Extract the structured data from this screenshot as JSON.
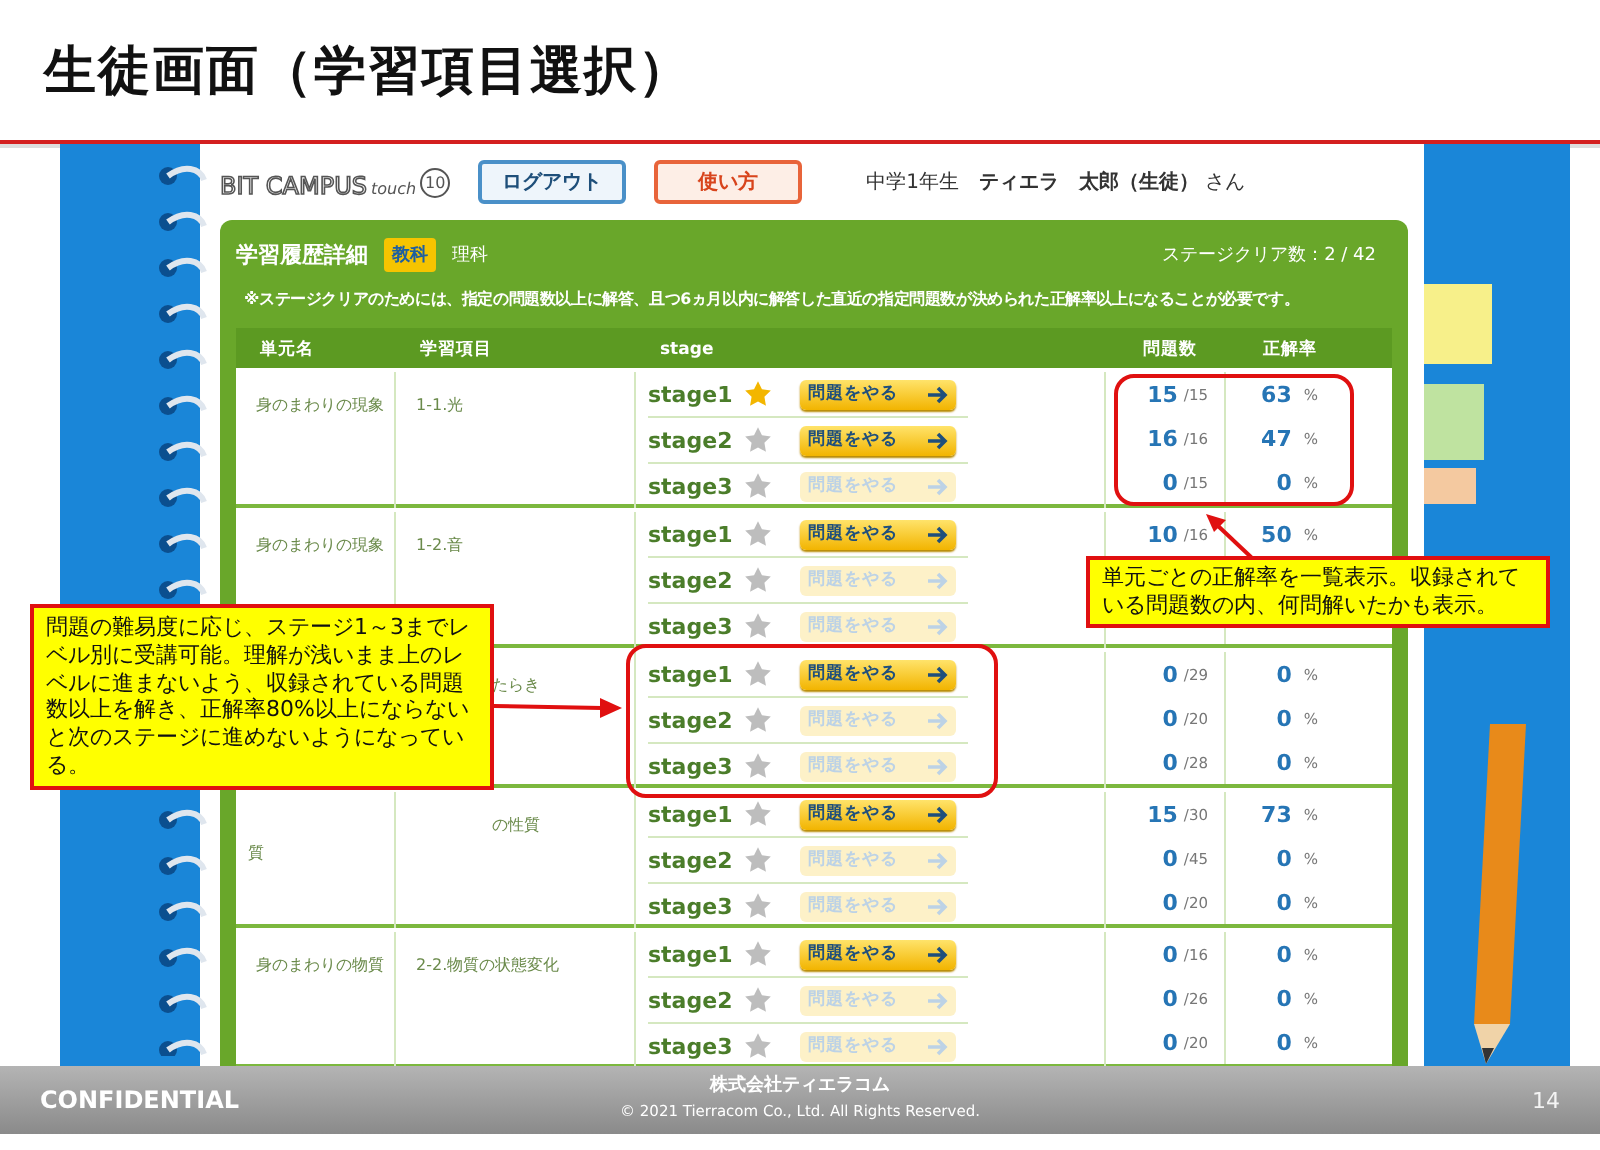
{
  "slide_title": "生徒画面（学習項目選択）",
  "app": {
    "logo": {
      "main": "BIT CAMPUS",
      "sub": "touch",
      "badge": "10"
    },
    "buttons": [
      {
        "label": "ログアウト",
        "kind": "logout"
      },
      {
        "label": "使い方",
        "kind": "help"
      }
    ],
    "user": {
      "grade": "中学1年生",
      "school": "ティエラ",
      "name": "太郎（生徒）",
      "suffix": "さん"
    },
    "panel": {
      "title": "学習履歴詳細",
      "subject_tag": "教科",
      "subject": "理科",
      "clear_count": "ステージクリア数：2 / 42",
      "note": "※ステージクリアのためには、指定の問題数以上に解答、且つ**6**ヵ月以内に解答した直近の指定問題数が決められた正解率以上になることが必要です。",
      "columns": [
        "単元名",
        "学習項目",
        "stage",
        "問題数",
        "正解率"
      ],
      "units": [
        {
          "unit": "身のまわりの現象",
          "item": "1-1.光",
          "covered": false,
          "stages": [
            {
              "label": "stage1",
              "cleared": true,
              "button": "問題をやる",
              "enabled": true,
              "solved": "15",
              "total": "/15",
              "rate": "63",
              "percent": "%"
            },
            {
              "label": "stage2",
              "cleared": false,
              "button": "問題をやる",
              "enabled": true,
              "solved": "16",
              "total": "/16",
              "rate": "47",
              "percent": "%"
            },
            {
              "label": "stage3",
              "cleared": false,
              "button": "問題をやる",
              "enabled": false,
              "solved": "0",
              "total": "/15",
              "rate": "0",
              "percent": "%"
            }
          ]
        },
        {
          "unit": "身のまわりの現象",
          "item": "1-2.音",
          "covered": false,
          "stages": [
            {
              "label": "stage1",
              "cleared": false,
              "button": "問題をやる",
              "enabled": true,
              "solved": "10",
              "total": "/16",
              "rate": "50",
              "percent": "%"
            },
            {
              "label": "stage2",
              "cleared": false,
              "button": "問題をやる",
              "enabled": false
            },
            {
              "label": "stage3",
              "cleared": false,
              "button": "問題をやる",
              "enabled": false
            }
          ]
        },
        {
          "item": "たらき",
          "covered": true,
          "stages": [
            {
              "label": "stage1",
              "cleared": false,
              "button": "問題をやる",
              "enabled": true,
              "solved": "0",
              "total": "/29",
              "rate": "0",
              "percent": "%"
            },
            {
              "label": "stage2",
              "cleared": false,
              "button": "問題をやる",
              "enabled": false,
              "solved": "0",
              "total": "/20",
              "rate": "0",
              "percent": "%"
            },
            {
              "label": "stage3",
              "cleared": false,
              "button": "問題をやる",
              "enabled": false,
              "solved": "0",
              "total": "/28",
              "rate": "0",
              "percent": "%"
            }
          ]
        },
        {
          "unit": "質",
          "item": "の性質",
          "covered": true,
          "stages": [
            {
              "label": "stage1",
              "cleared": false,
              "button": "問題をやる",
              "enabled": true,
              "solved": "15",
              "total": "/30",
              "rate": "73",
              "percent": "%"
            },
            {
              "label": "stage2",
              "cleared": false,
              "button": "問題をやる",
              "enabled": false,
              "solved": "0",
              "total": "/45",
              "rate": "0",
              "percent": "%"
            },
            {
              "label": "stage3",
              "cleared": false,
              "button": "問題をやる",
              "enabled": false,
              "solved": "0",
              "total": "/20",
              "rate": "0",
              "percent": "%"
            }
          ]
        },
        {
          "unit": "身のまわりの物質",
          "item": "2-2.物質の状態変化",
          "covered": false,
          "stages": [
            {
              "label": "stage1",
              "cleared": false,
              "button": "問題をやる",
              "enabled": true,
              "solved": "0",
              "total": "/16",
              "rate": "0",
              "percent": "%"
            },
            {
              "label": "stage2",
              "cleared": false,
              "button": "問題をやる",
              "enabled": false,
              "solved": "0",
              "total": "/26",
              "rate": "0",
              "percent": "%"
            },
            {
              "label": "stage3",
              "cleared": false,
              "button": "問題をやる",
              "enabled": false,
              "solved": "0",
              "total": "/20",
              "rate": "0",
              "percent": "%"
            }
          ]
        }
      ]
    }
  },
  "callouts": [
    {
      "text": "問題の難易度に応じ、ステージ1～3までレベル別に受講可能。理解が浅いまま上のレベルに進まないよう、収録されている問題数以上を解き、正解率80%以上にならないと次のステージに進めないようになっている。"
    },
    {
      "text": "単元ごとの正解率を一覧表示。収録されている問題数の内、何問解いたかも表示。"
    }
  ],
  "footer": {
    "label": "CONFIDENTIAL",
    "company": "株式会社ティエラコム",
    "copyright": "© 2021  Tierracom Co., Ltd. All Rights Reserved.",
    "page": "14"
  }
}
